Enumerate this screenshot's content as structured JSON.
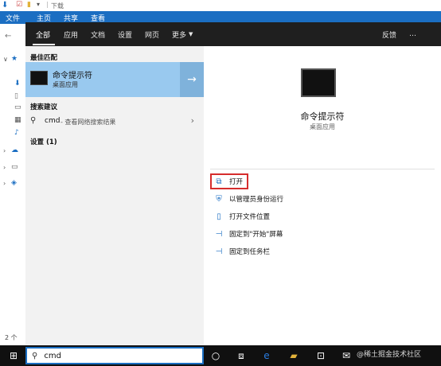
{
  "explorer": {
    "title_suffix": "下载",
    "ribbon": {
      "file": "文件",
      "tabs": [
        "主页",
        "共享",
        "查看"
      ]
    },
    "status": "2 个"
  },
  "search": {
    "tabs": [
      "全部",
      "应用",
      "文档",
      "设置",
      "网页",
      "更多"
    ],
    "feedback": "反馈",
    "more_icon": "…",
    "best_match": {
      "section": "最佳匹配",
      "title": "命令提示符",
      "subtitle": "桌面应用"
    },
    "suggestions": {
      "section": "搜索建议",
      "query": "cmd",
      "hint": " - 查看网络搜索结果"
    },
    "settings_section": "设置 (1)",
    "preview": {
      "title": "命令提示符",
      "subtitle": "桌面应用"
    },
    "actions": [
      "打开",
      "以管理员身份运行",
      "打开文件位置",
      "固定到\"开始\"屏幕",
      "固定到任务栏"
    ],
    "input_value": "cmd"
  },
  "taskbar": {
    "watermark": "@稀土掘金技术社区"
  }
}
